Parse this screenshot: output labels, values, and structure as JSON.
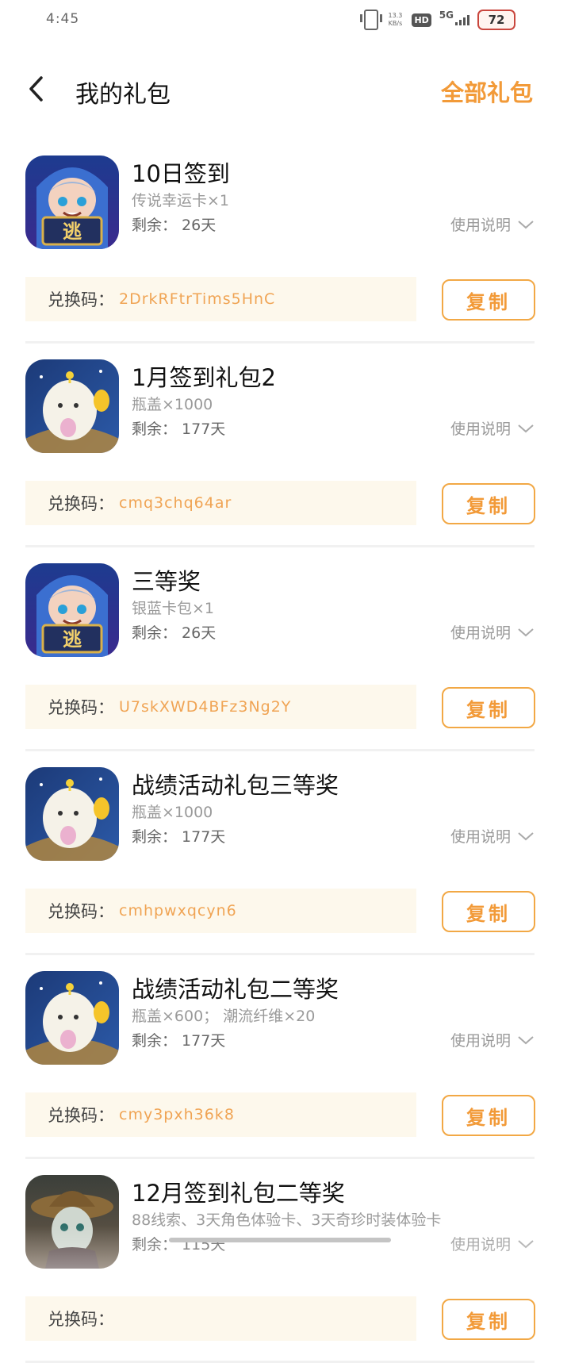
{
  "status_bar": {
    "time": "4:45",
    "net_speed_value": "13.3",
    "net_speed_unit": "KB/s",
    "hd": "HD",
    "network": "5G",
    "battery": "72"
  },
  "header": {
    "title": "我的礼包",
    "all_gifts_label": "全部礼包",
    "back_icon": "chevron-left-icon"
  },
  "labels": {
    "usage_note": "使用说明",
    "code_label": "兑换码：",
    "copy_button": "复制"
  },
  "colors": {
    "accent": "#f29a38",
    "code_bg": "#fdf8ec"
  },
  "gifts": [
    {
      "name": "10日签到",
      "content": "传说幸运卡×1",
      "remaining": "剩余： 26天",
      "code": "2DrkRFtrTims5HnC",
      "icon": "hooded-boy-game-icon"
    },
    {
      "name": "1月签到礼包2",
      "content": "瓶盖×1000",
      "remaining": "剩余： 177天",
      "code": "cmq3chq64ar",
      "icon": "egg-mascot-game-icon"
    },
    {
      "name": "三等奖",
      "content": "银蓝卡包×1",
      "remaining": "剩余： 26天",
      "code": "U7skXWD4BFz3Ng2Y",
      "icon": "hooded-boy-game-icon"
    },
    {
      "name": "战绩活动礼包三等奖",
      "content": "瓶盖×1000",
      "remaining": "剩余： 177天",
      "code": "cmhpwxqcyn6",
      "icon": "egg-mascot-game-icon"
    },
    {
      "name": "战绩活动礼包二等奖",
      "content": "瓶盖×600； 潮流纤维×20",
      "remaining": "剩余： 177天",
      "code": "cmy3pxh36k8",
      "icon": "egg-mascot-game-icon"
    },
    {
      "name": "12月签到礼包二等奖",
      "content": "88线索、3天角色体验卡、3天奇珍时装体验卡",
      "remaining": "剩余： 115天",
      "code": "",
      "icon": "straw-hat-girl-game-icon"
    }
  ]
}
